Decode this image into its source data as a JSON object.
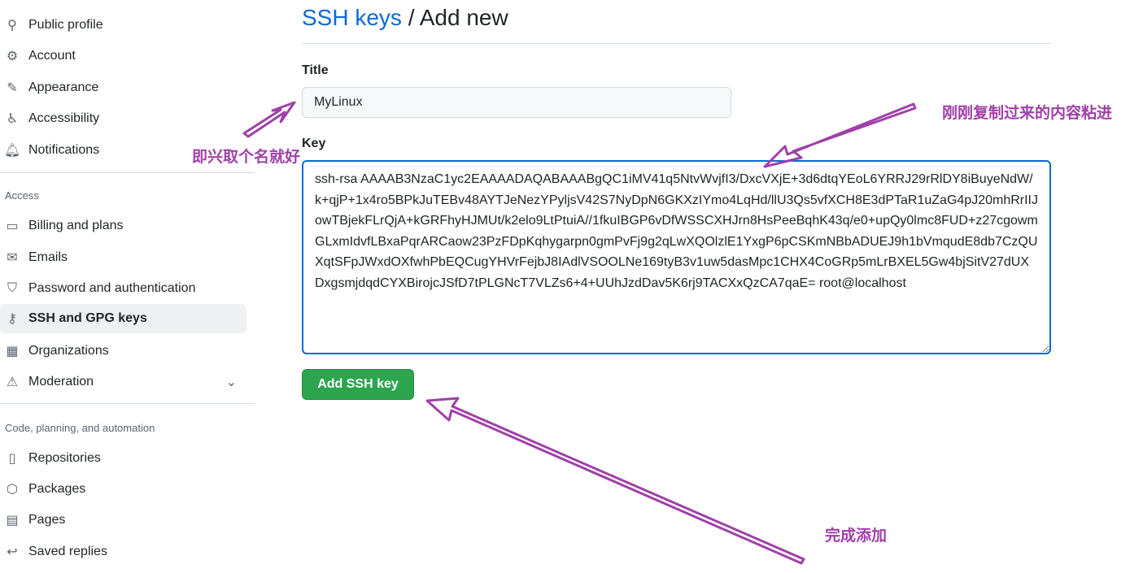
{
  "sidebar": {
    "items": [
      {
        "label": "Public profile",
        "icon": "person-icon"
      },
      {
        "label": "Account",
        "icon": "gear-icon"
      },
      {
        "label": "Appearance",
        "icon": "paintbrush-icon"
      },
      {
        "label": "Accessibility",
        "icon": "accessibility-icon"
      },
      {
        "label": "Notifications",
        "icon": "bell-icon"
      }
    ],
    "access_heading": "Access",
    "access_items": [
      {
        "label": "Billing and plans",
        "icon": "credit-card-icon"
      },
      {
        "label": "Emails",
        "icon": "mail-icon"
      },
      {
        "label": "Password and authentication",
        "icon": "shield-icon"
      },
      {
        "label": "SSH and GPG keys",
        "icon": "key-icon",
        "active": true
      },
      {
        "label": "Organizations",
        "icon": "organization-icon"
      },
      {
        "label": "Moderation",
        "icon": "report-icon"
      }
    ],
    "code_heading": "Code, planning, and automation",
    "code_items": [
      {
        "label": "Repositories",
        "icon": "repo-icon"
      },
      {
        "label": "Packages",
        "icon": "package-icon"
      },
      {
        "label": "Pages",
        "icon": "browser-icon"
      },
      {
        "label": "Saved replies",
        "icon": "reply-icon"
      }
    ]
  },
  "main": {
    "breadcrumb_link": "SSH keys",
    "breadcrumb_sep": " / ",
    "breadcrumb_current": "Add new",
    "title_label": "Title",
    "title_value": "MyLinux",
    "key_label": "Key",
    "key_value": "ssh-rsa AAAAB3NzaC1yc2EAAAADAQABAAABgQC1iMV41q5NtvWvjfI3/DxcVXjE+3d6dtqYEoL6YRRJ29rRlDY8iBuyeNdW/k+qjP+1x4ro5BPkJuTEBv48AYTJeNezYPyljsV42S7NyDpN6GKXzIYmo4LqHd/llU3Qs5vfXCH8E3dPTaR1uZaG4pJ20mhRrIIJowTBjekFLrQjA+kGRFhyHJMUt/k2elo9LtPtuiA//1fkuIBGP6vDfWSSCXHJrn8HsPeeBqhK43q/e0+upQy0lmc8FUD+z27cgowmGLxmIdvfLBxaPqrARCaow23PzFDpKqhygarpn0gmPvFj9g2qLwXQOlzlE1YxgP6pCSKmNBbADUEJ9h1bVmqudE8db7CzQUXqtSFpJWxdOXfwhPbEQCugYHVrFejbJ8IAdlVSOOLNe169tyB3v1uw5dasMpc1CHX4CoGRp5mLrBXEL5Gw4bjSitV27dUXDxgsmjdqdCYXBirojcJSfD7tPLGNcT7VLZs6+4+UUhJzdDav5K6rj9TACXxQzCA7qaE= root@localhost",
    "submit_label": "Add SSH key"
  },
  "annotations": {
    "title_note": "即兴取个名就好",
    "key_note": "刚刚复制过来的内容粘进",
    "button_note": "完成添加",
    "color": "#a040a8"
  }
}
